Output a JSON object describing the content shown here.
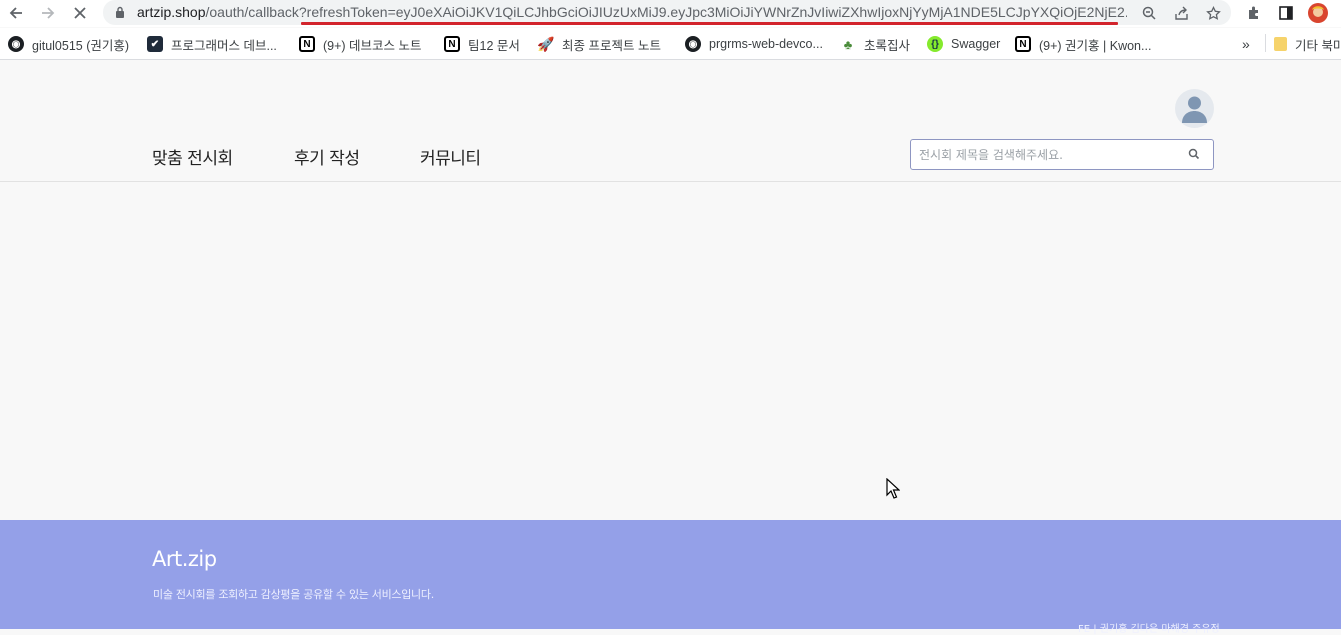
{
  "browser": {
    "url_host": "artzip.shop",
    "url_path": "/oauth/callback?refreshToken=eyJ0eXAiOiJKV1QiLCJhbGciOiJIUzUxMiJ9.eyJpc3MiOiJiYWNrZnJvIiwiZXhwIjoxNjYyMjA1NDE5LCJpYXQiOjE2NjE2...",
    "nav_icons": [
      "back-arrow-icon",
      "forward-arrow-icon",
      "stop-loading-icon"
    ],
    "omnibox_icons": [
      "zoom-icon",
      "share-icon",
      "bookmark-star-icon"
    ],
    "toolbar_icons": [
      "extensions-icon",
      "side-panel-icon",
      "profile-avatar-icon"
    ]
  },
  "bookmarks": [
    {
      "label": "gitul0515 (권기홍)",
      "icon": "github-icon"
    },
    {
      "label": "프로그래머스 데브...",
      "icon": "programmers-icon"
    },
    {
      "label": "(9+) 데브코스 노트",
      "icon": "notion-icon"
    },
    {
      "label": "팀12 문서",
      "icon": "notion-icon"
    },
    {
      "label": "최종 프로젝트 노트",
      "icon": "rocket-icon"
    },
    {
      "label": "prgrms-web-devco...",
      "icon": "github-icon"
    },
    {
      "label": "초록집사",
      "icon": "plant-icon"
    },
    {
      "label": "Swagger",
      "icon": "swagger-icon"
    },
    {
      "label": "(9+) 권기홍 | Kwon...",
      "icon": "notion-icon"
    }
  ],
  "bookmarks_more": "»",
  "other_bookmarks": "기타 북마",
  "header": {
    "menu": [
      "맞춤 전시회",
      "후기 작성",
      "커뮤니티"
    ],
    "search_placeholder": "전시회 제목을 검색해주세요."
  },
  "footer": {
    "title": "Art.zip",
    "description": "미술 전시회를 조회하고 감상평을 공유할 수 있는 서비스입니다.",
    "credit": "FE | 권기홍 김다은 마해경 주유정"
  },
  "colors": {
    "footer_bg": "#94a0e8",
    "url_highlight": "#d2242c",
    "search_border": "#8e96c2"
  }
}
